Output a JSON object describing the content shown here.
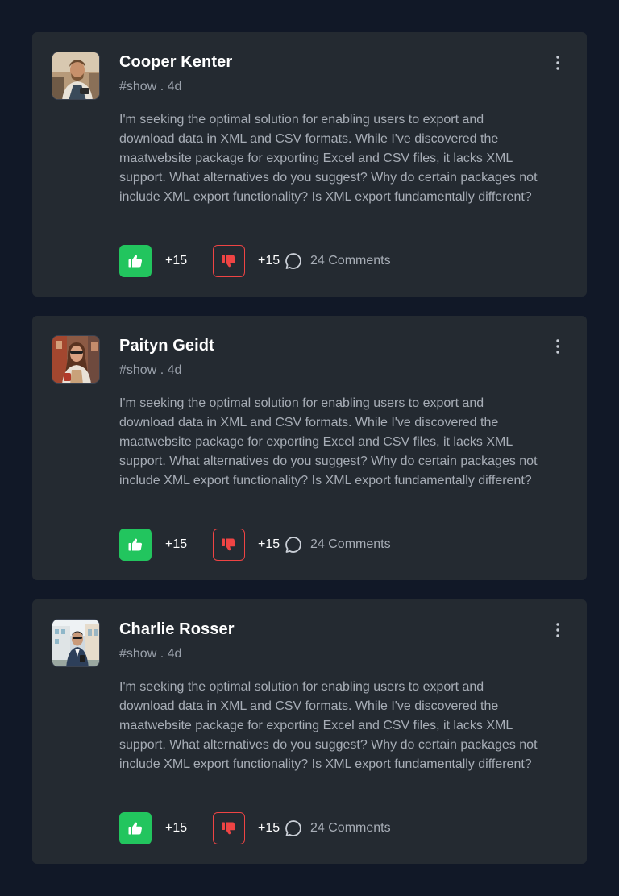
{
  "colors": {
    "background": "#111827",
    "card": "#242a31",
    "like": "#22c55e",
    "dislike": "#ef4444"
  },
  "posts": [
    {
      "author": "Cooper Kenter",
      "avatar_icon": "avatar-photo-man-outdoor",
      "tag": "#show",
      "separator": ".",
      "age": "4d",
      "body": "I'm seeking the optimal solution for enabling users to export and download data in XML and CSV formats. While I've discovered the maatwebsite package for exporting Excel and CSV files, it lacks XML support. What alternatives do you suggest? Why do certain packages not include XML export functionality? Is XML export fundamentally different?",
      "likes": "+15",
      "dislikes": "+15",
      "comments": "24 Comments"
    },
    {
      "author": "Paityn Geidt",
      "avatar_icon": "avatar-photo-woman-city",
      "tag": "#show",
      "separator": ".",
      "age": "4d",
      "body": "I'm seeking the optimal solution for enabling users to export and download data in XML and CSV formats. While I've discovered the maatwebsite package for exporting Excel and CSV files, it lacks XML support. What alternatives do you suggest? Why do certain packages not include XML export functionality? Is XML export fundamentally different?",
      "likes": "+15",
      "dislikes": "+15",
      "comments": "24 Comments"
    },
    {
      "author": "Charlie Rosser",
      "avatar_icon": "avatar-photo-man-suit",
      "tag": "#show",
      "separator": ".",
      "age": "4d",
      "body": "I'm seeking the optimal solution for enabling users to export and download data in XML and CSV formats. While I've discovered the maatwebsite package for exporting Excel and CSV files, it lacks XML support. What alternatives do you suggest? Why do certain packages not include XML export functionality? Is XML export fundamentally different?",
      "likes": "+15",
      "dislikes": "+15",
      "comments": "24 Comments"
    }
  ]
}
